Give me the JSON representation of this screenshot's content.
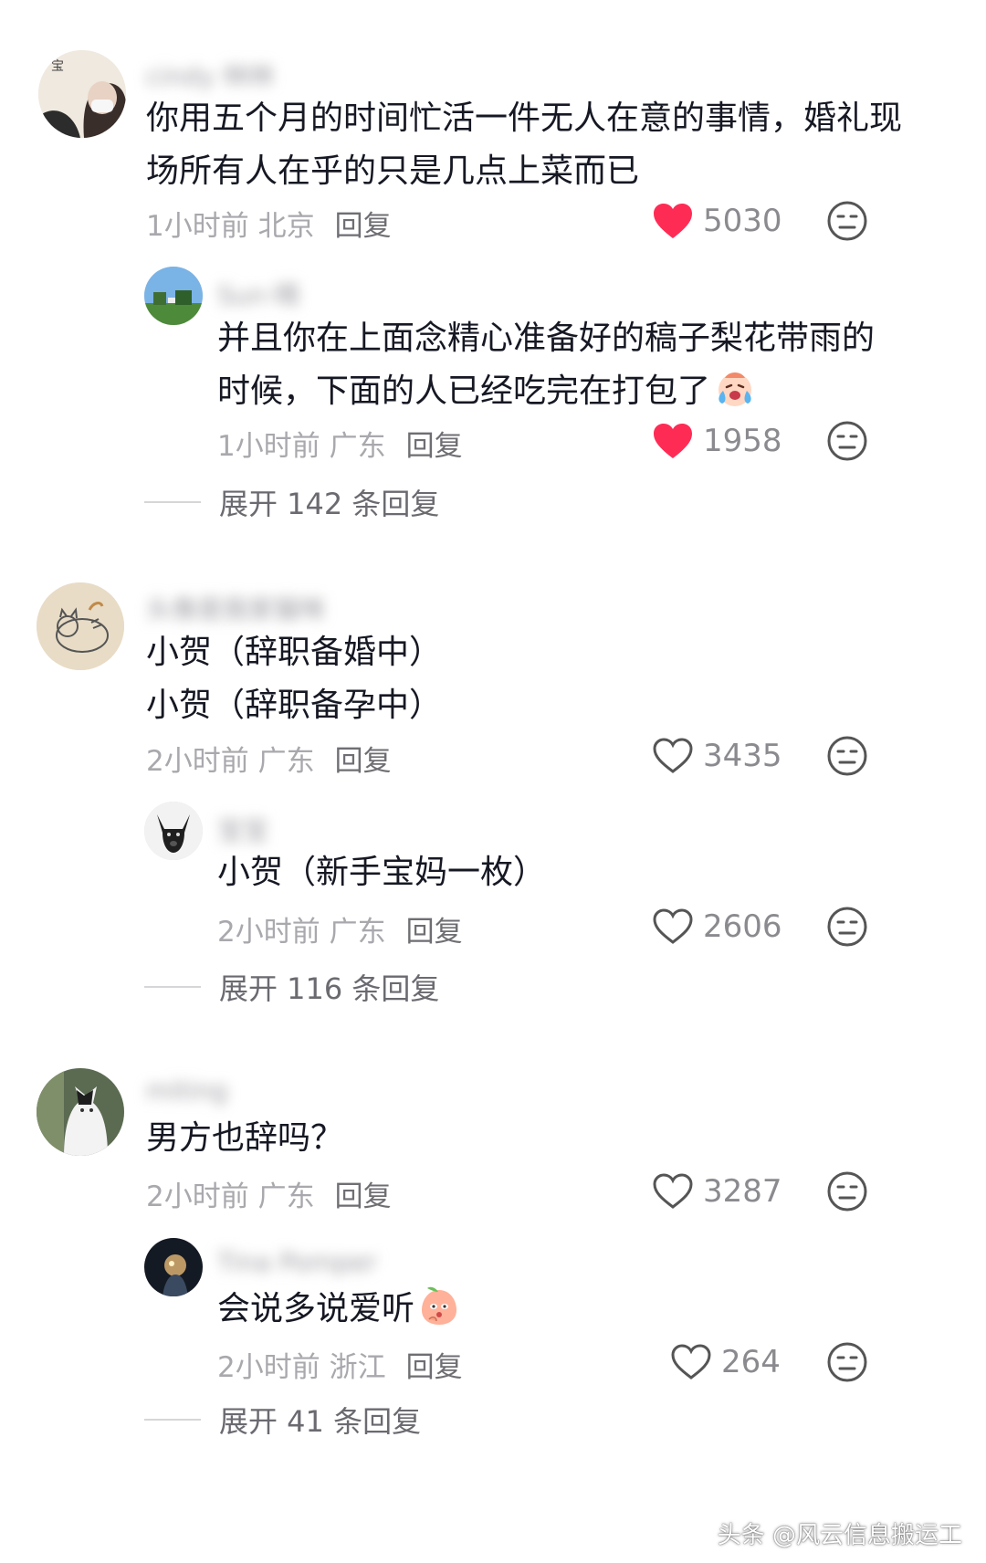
{
  "comments": [
    {
      "username": "cindy 林林",
      "lines": [
        "你用五个月的时间忙活一件无人在意的事情，婚礼现",
        "场所有人在乎的只是几点上菜而已"
      ],
      "time_location": "1小时前 北京",
      "reply_label": "回复",
      "likes": "5030",
      "liked": true,
      "reply": {
        "username": "Sun·晴",
        "lines": [
          "并且你在上面念精心准备好的稿子梨花带雨的",
          "时候，下面的人已经吃完在打包了"
        ],
        "emoji": "crying-laughing-emoji",
        "time_location": "1小时前 广东",
        "reply_label": "回复",
        "likes": "1958",
        "liked": true
      },
      "expand_label": "展开 142 条回复"
    },
    {
      "username": "头像是我家猫咪",
      "lines": [
        "小贺（辞职备婚中）",
        "小贺（辞职备孕中）"
      ],
      "time_location": "2小时前 广东",
      "reply_label": "回复",
      "likes": "3435",
      "liked": false,
      "reply": {
        "username": "宝宝",
        "lines": [
          "小贺（新手宝妈一枚）"
        ],
        "time_location": "2小时前 广东",
        "reply_label": "回复",
        "likes": "2606",
        "liked": false
      },
      "expand_label": "展开 116 条回复"
    },
    {
      "username": "miting",
      "lines": [
        "男方也辞吗？"
      ],
      "time_location": "2小时前 广东",
      "reply_label": "回复",
      "likes": "3287",
      "liked": false,
      "reply": {
        "username": "Tina Pomper",
        "lines": [
          "会说多说爱听"
        ],
        "emoji": "peach-thinking-emoji",
        "time_location": "2小时前 浙江",
        "reply_label": "回复",
        "likes": "264",
        "liked": false
      },
      "expand_label": "展开 41 条回复"
    }
  ],
  "watermark": "头条 @风云信息搬运工",
  "colors": {
    "liked_heart": "#fe2c55",
    "muted_text": "#a8a8ad",
    "main_text": "#161823"
  }
}
